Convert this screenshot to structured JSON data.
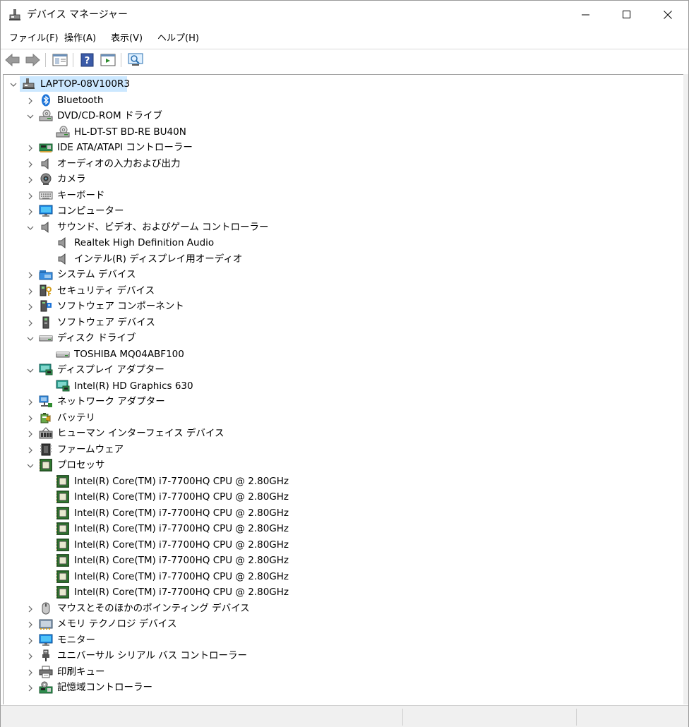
{
  "window": {
    "title": "デバイス マネージャー"
  },
  "menu": [
    "ファイル(F)",
    "操作(A)",
    "表示(V)",
    "ヘルプ(H)"
  ],
  "tree": {
    "root": "LAPTOP-08V100R3",
    "items": [
      {
        "label": "Bluetooth",
        "icon": "bluetooth-icon",
        "expanded": false,
        "children": []
      },
      {
        "label": "DVD/CD-ROM ドライブ",
        "icon": "dvd-drive-icon",
        "expanded": true,
        "children": [
          {
            "label": "HL-DT-ST BD-RE BU40N",
            "icon": "dvd-drive-icon"
          }
        ]
      },
      {
        "label": "IDE ATA/ATAPI コントローラー",
        "icon": "ide-controller-icon",
        "expanded": false,
        "children": []
      },
      {
        "label": "オーディオの入力および出力",
        "icon": "speaker-icon",
        "expanded": false,
        "children": []
      },
      {
        "label": "カメラ",
        "icon": "camera-icon",
        "expanded": false,
        "children": []
      },
      {
        "label": "キーボード",
        "icon": "keyboard-icon",
        "expanded": false,
        "children": []
      },
      {
        "label": "コンピューター",
        "icon": "monitor-icon",
        "expanded": false,
        "children": []
      },
      {
        "label": "サウンド、ビデオ、およびゲーム コントローラー",
        "icon": "speaker-icon",
        "expanded": true,
        "children": [
          {
            "label": "Realtek High Definition Audio",
            "icon": "speaker-icon"
          },
          {
            "label": "インテル(R) ディスプレイ用オーディオ",
            "icon": "speaker-icon"
          }
        ]
      },
      {
        "label": "システム デバイス",
        "icon": "system-folder-icon",
        "expanded": false,
        "children": []
      },
      {
        "label": "セキュリティ デバイス",
        "icon": "security-key-icon",
        "expanded": false,
        "children": []
      },
      {
        "label": "ソフトウェア コンポーネント",
        "icon": "software-component-icon",
        "expanded": false,
        "children": []
      },
      {
        "label": "ソフトウェア デバイス",
        "icon": "software-device-icon",
        "expanded": false,
        "children": []
      },
      {
        "label": "ディスク ドライブ",
        "icon": "disk-drive-icon",
        "expanded": true,
        "children": [
          {
            "label": "TOSHIBA MQ04ABF100",
            "icon": "disk-drive-icon"
          }
        ]
      },
      {
        "label": "ディスプレイ アダプター",
        "icon": "display-adapter-icon",
        "expanded": true,
        "children": [
          {
            "label": "Intel(R) HD Graphics 630",
            "icon": "display-adapter-icon"
          }
        ]
      },
      {
        "label": "ネットワーク アダプター",
        "icon": "network-icon",
        "expanded": false,
        "children": []
      },
      {
        "label": "バッテリ",
        "icon": "battery-icon",
        "expanded": false,
        "children": []
      },
      {
        "label": "ヒューマン インターフェイス デバイス",
        "icon": "hid-icon",
        "expanded": false,
        "children": []
      },
      {
        "label": "ファームウェア",
        "icon": "firmware-chip-icon",
        "expanded": false,
        "children": []
      },
      {
        "label": "プロセッサ",
        "icon": "processor-icon",
        "expanded": true,
        "children": [
          {
            "label": "Intel(R) Core(TM) i7-7700HQ CPU @ 2.80GHz",
            "icon": "processor-icon"
          },
          {
            "label": "Intel(R) Core(TM) i7-7700HQ CPU @ 2.80GHz",
            "icon": "processor-icon"
          },
          {
            "label": "Intel(R) Core(TM) i7-7700HQ CPU @ 2.80GHz",
            "icon": "processor-icon"
          },
          {
            "label": "Intel(R) Core(TM) i7-7700HQ CPU @ 2.80GHz",
            "icon": "processor-icon"
          },
          {
            "label": "Intel(R) Core(TM) i7-7700HQ CPU @ 2.80GHz",
            "icon": "processor-icon"
          },
          {
            "label": "Intel(R) Core(TM) i7-7700HQ CPU @ 2.80GHz",
            "icon": "processor-icon"
          },
          {
            "label": "Intel(R) Core(TM) i7-7700HQ CPU @ 2.80GHz",
            "icon": "processor-icon"
          },
          {
            "label": "Intel(R) Core(TM) i7-7700HQ CPU @ 2.80GHz",
            "icon": "processor-icon"
          }
        ]
      },
      {
        "label": "マウスとそのほかのポインティング デバイス",
        "icon": "mouse-icon",
        "expanded": false,
        "children": []
      },
      {
        "label": "メモリ テクノロジ デバイス",
        "icon": "memory-device-icon",
        "expanded": false,
        "children": []
      },
      {
        "label": "モニター",
        "icon": "monitor-icon",
        "expanded": false,
        "children": []
      },
      {
        "label": "ユニバーサル シリアル バス コントローラー",
        "icon": "usb-icon",
        "expanded": false,
        "children": []
      },
      {
        "label": "印刷キュー",
        "icon": "printer-icon",
        "expanded": false,
        "children": []
      },
      {
        "label": "記憶域コントローラー",
        "icon": "storage-controller-icon",
        "expanded": false,
        "children": []
      }
    ]
  },
  "colors": {
    "selection": "#cce8ff",
    "chevron": "#606060",
    "accent": "#0078d7"
  }
}
